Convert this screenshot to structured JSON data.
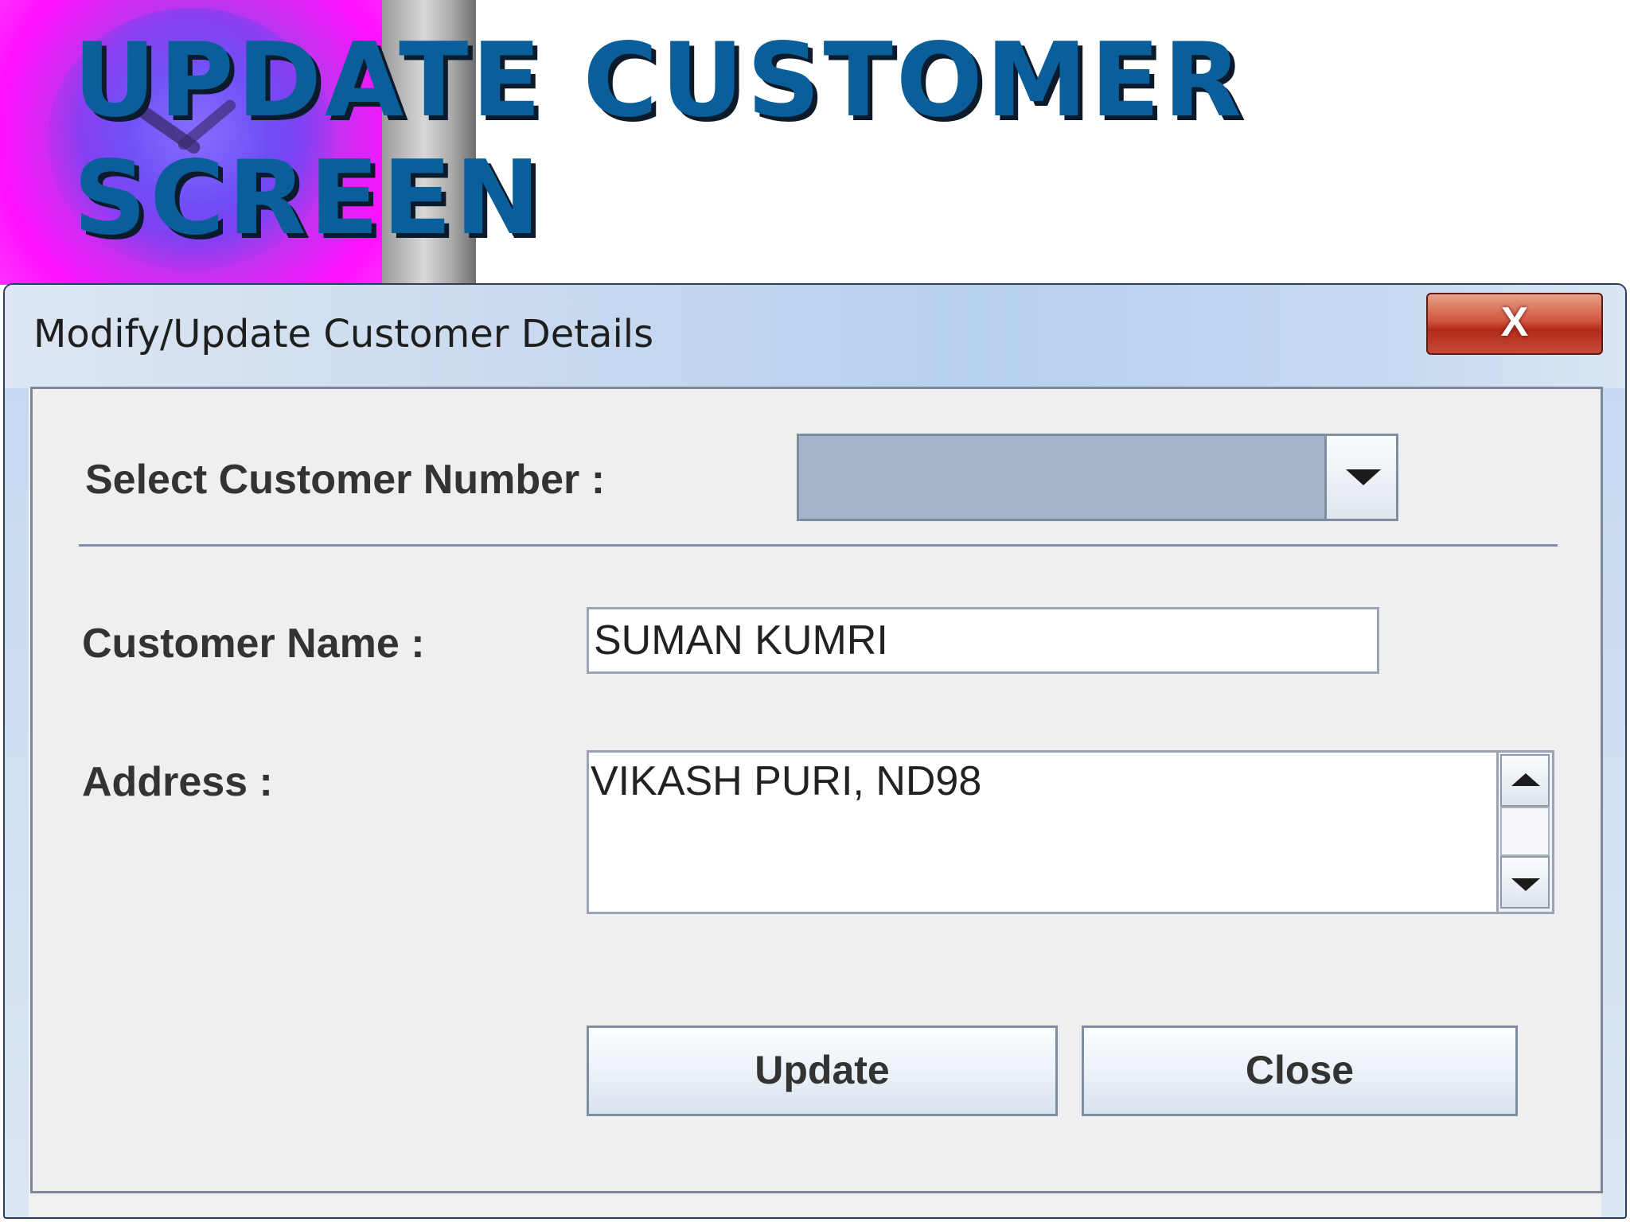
{
  "slide": {
    "title": "UPDATE CUSTOMER SCREEN",
    "title_line1": "UPDATE CUSTOMER",
    "title_line2": "SCREEN"
  },
  "window": {
    "title": "Modify/Update Customer Details",
    "close_glyph": "X",
    "close_icon": "close-icon"
  },
  "form": {
    "customer_number": {
      "label": "Select Customer Number :",
      "selected_value": "",
      "dropdown_icon": "chevron-down-icon"
    },
    "customer_name": {
      "label": "Customer Name :",
      "value": "SUMAN KUMRI"
    },
    "address": {
      "label": "Address :",
      "value": "VIKASH PURI, ND98",
      "scroll_up_icon": "arrow-up-icon",
      "scroll_down_icon": "arrow-down-icon"
    }
  },
  "buttons": {
    "update_label": "Update",
    "close_label": "Close"
  },
  "colors": {
    "title_text": "#0a5f9a",
    "titlebar": "#c6d9f1",
    "close_button": "#c74a36",
    "combo_fill": "#a5b5cc",
    "panel_bg": "#efeff2"
  }
}
